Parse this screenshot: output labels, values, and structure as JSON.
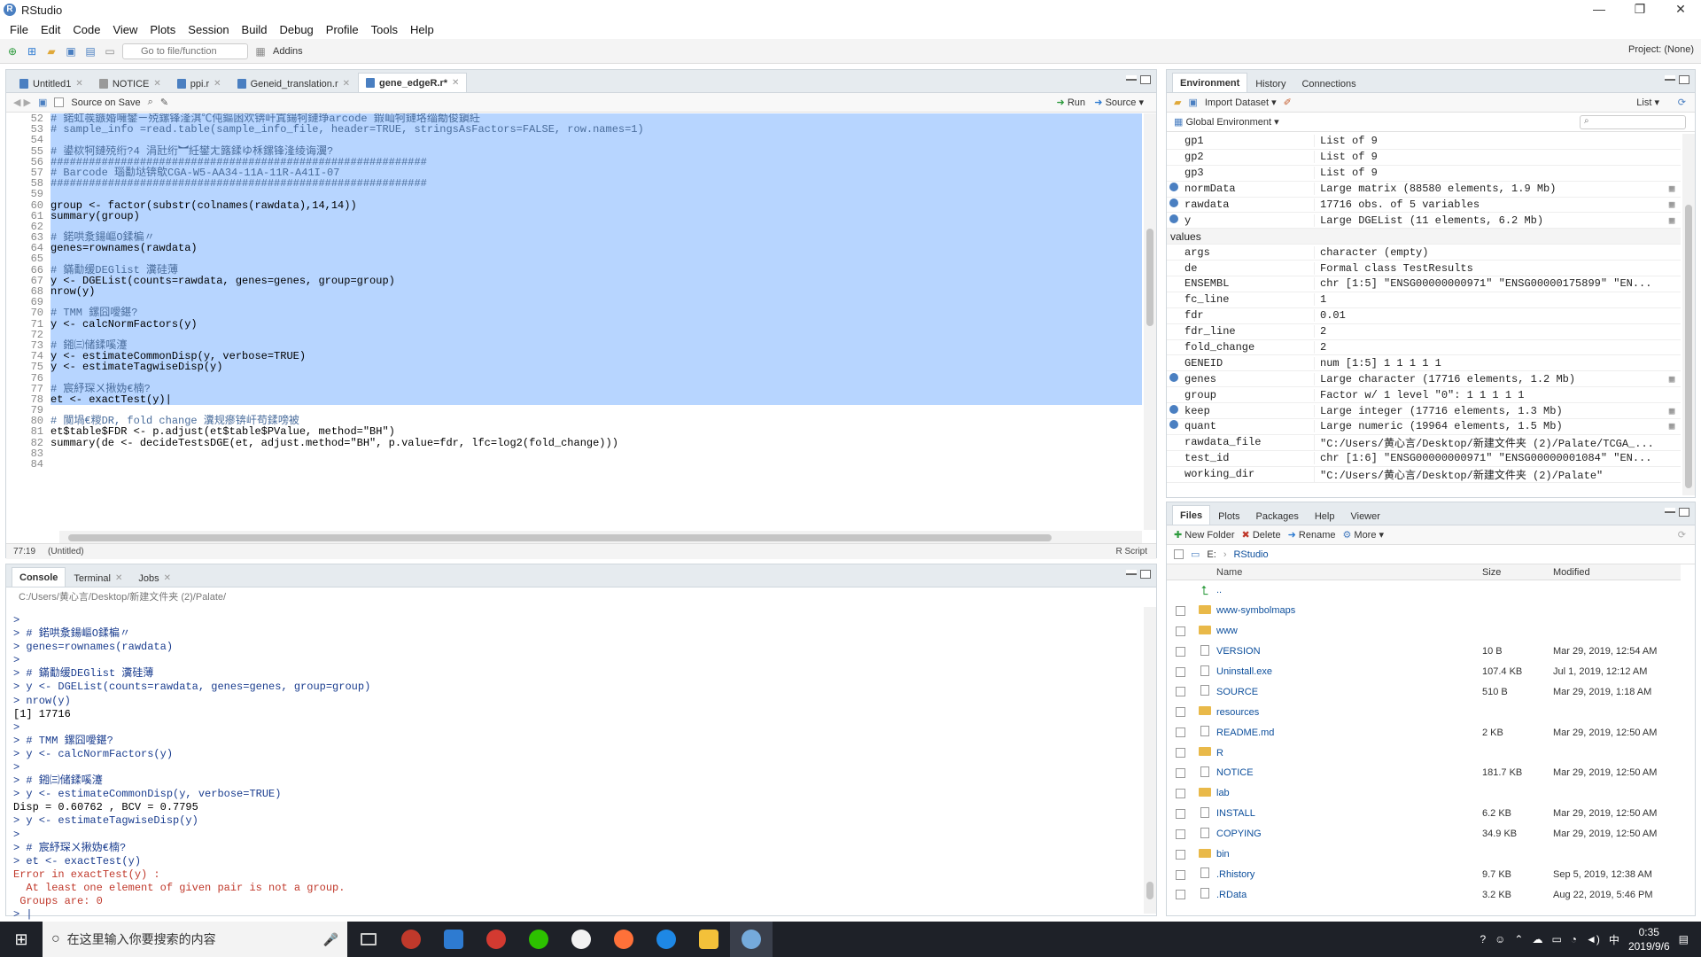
{
  "window": {
    "title": "RStudio",
    "controls": [
      "—",
      "❐",
      "✕"
    ]
  },
  "menu": [
    "File",
    "Edit",
    "Code",
    "View",
    "Plots",
    "Session",
    "Build",
    "Debug",
    "Profile",
    "Tools",
    "Help"
  ],
  "toolbar": {
    "goto_placeholder": "Go to file/function",
    "addins": "Addins",
    "project": "Project: (None)"
  },
  "editor": {
    "tabs": [
      {
        "label": "Untitled1",
        "active": false
      },
      {
        "label": "NOTICE",
        "active": false
      },
      {
        "label": "ppi.r",
        "active": false
      },
      {
        "label": "Geneid_translation.r",
        "active": false
      },
      {
        "label": "gene_edgeR.r*",
        "active": true
      }
    ],
    "source_on_save": "Source on Save",
    "run": "Run",
    "source": "Source",
    "lines": [
      {
        "n": "52",
        "t": "# 鍩虹彂鏃婚噰鐢ㄧ殑鏍锋湰淇℃伅鏂囦欢锛屽寘鍚牱鏈琤arcode 鍜屾牱鏈垎缁勪俊鎭紝",
        "sel": true,
        "cm": true
      },
      {
        "n": "53",
        "t": "# sample_info =read.table(sample_info_file, header=TRUE, stringsAsFactors=FALSE, row.names=1)",
        "sel": true,
        "cm": true
      },
      {
        "n": "54",
        "t": "",
        "sel": true
      },
      {
        "n": "55",
        "t": "# 鍙栨牱鏈殑绗?4 涓瓧绗︼紝鐢ㄤ簬鍒ゆ柇鏍锋湰绫诲瀷?",
        "sel": true,
        "cm": true
      },
      {
        "n": "56",
        "t": "###########################################################",
        "sel": true,
        "cm": true
      },
      {
        "n": "57",
        "t": "# Barcode 瑙勫垯锛歍CGA-W5-AA34-11A-11R-A41I-07",
        "sel": true,
        "cm": true
      },
      {
        "n": "58",
        "t": "###########################################################",
        "sel": true,
        "cm": true
      },
      {
        "n": "59",
        "t": "",
        "sel": true
      },
      {
        "n": "60",
        "t": "group <- factor(substr(colnames(rawdata),14,14))",
        "sel": true
      },
      {
        "n": "61",
        "t": "summary(group)",
        "sel": true
      },
      {
        "n": "62",
        "t": "",
        "sel": true
      },
      {
        "n": "63",
        "t": "# 鍩哄洜鍚嶇О鍒楄〃",
        "sel": true,
        "cm": true
      },
      {
        "n": "64",
        "t": "genes=rownames(rawdata)",
        "sel": true
      },
      {
        "n": "65",
        "t": "",
        "sel": true
      },
      {
        "n": "66",
        "t": "# 鏋勫缓DEGlist 瀵硅薄",
        "sel": true,
        "cm": true
      },
      {
        "n": "67",
        "t": "y <- DGEList(counts=rawdata, genes=genes, group=group)",
        "sel": true
      },
      {
        "n": "68",
        "t": "nrow(y)",
        "sel": true
      },
      {
        "n": "69",
        "t": "",
        "sel": true
      },
      {
        "n": "70",
        "t": "# TMM 鏍囧噯鍖?",
        "sel": true,
        "cm": true
      },
      {
        "n": "71",
        "t": "y <- calcNormFactors(y)",
        "sel": true
      },
      {
        "n": "72",
        "t": "",
        "sel": true
      },
      {
        "n": "73",
        "t": "# 鎺㈢储鍒嗘瀽",
        "sel": true,
        "cm": true
      },
      {
        "n": "74",
        "t": "y <- estimateCommonDisp(y, verbose=TRUE)",
        "sel": true
      },
      {
        "n": "75",
        "t": "y <- estimateTagwiseDisp(y)",
        "sel": true
      },
      {
        "n": "76",
        "t": "",
        "sel": true
      },
      {
        "n": "77",
        "t": "# 宸紓琛ㄨ揪妫€楠?",
        "sel": true,
        "cm": true
      },
      {
        "n": "78",
        "t": "et <- exactTest(y)|",
        "sel": true
      },
      {
        "n": "79",
        "t": "",
        "sel": false
      },
      {
        "n": "80",
        "t": "# 闃堝€糉DR, fold change 瀵规瘮锛屽苟鍒嗙被",
        "sel": false,
        "cm": true
      },
      {
        "n": "81",
        "t": "et$table$FDR <- p.adjust(et$table$PValue, method=\"BH\")",
        "sel": false
      },
      {
        "n": "82",
        "t": "summary(de <- decideTestsDGE(et, adjust.method=\"BH\", p.value=fdr, lfc=log2(fold_change)))",
        "sel": false
      },
      {
        "n": "83",
        "t": "",
        "sel": false
      },
      {
        "n": "84",
        "t": "",
        "sel": false
      }
    ],
    "status_pos": "77:19",
    "status_scope": "(Untitled)",
    "status_type": "R Script"
  },
  "console": {
    "tabs": [
      "Console",
      "Terminal",
      "Jobs"
    ],
    "path": "C:/Users/黄心言/Desktop/新建文件夹 (2)/Palate/",
    "lines": [
      {
        "c": "p",
        "t": ">"
      },
      {
        "c": "p",
        "t": "> # 鍩哄洜鍚嶇О鍒楄〃"
      },
      {
        "c": "p",
        "t": "> genes=rownames(rawdata)"
      },
      {
        "c": "p",
        "t": ">"
      },
      {
        "c": "p",
        "t": "> # 鏋勫缓DEGlist 瀵硅薄"
      },
      {
        "c": "p",
        "t": "> y <- DGEList(counts=rawdata, genes=genes, group=group)"
      },
      {
        "c": "p",
        "t": "> nrow(y)"
      },
      {
        "c": "o",
        "t": "[1] 17716"
      },
      {
        "c": "p",
        "t": ">"
      },
      {
        "c": "p",
        "t": "> # TMM 鏍囧噯鍖?"
      },
      {
        "c": "p",
        "t": "> y <- calcNormFactors(y)"
      },
      {
        "c": "p",
        "t": ">"
      },
      {
        "c": "p",
        "t": "> # 鎺㈢储鍒嗘瀽"
      },
      {
        "c": "p",
        "t": "> y <- estimateCommonDisp(y, verbose=TRUE)"
      },
      {
        "c": "o",
        "t": "Disp = 0.60762 , BCV = 0.7795"
      },
      {
        "c": "p",
        "t": "> y <- estimateTagwiseDisp(y)"
      },
      {
        "c": "p",
        "t": ">"
      },
      {
        "c": "p",
        "t": "> # 宸紓琛ㄨ揪妫€楠?"
      },
      {
        "c": "p",
        "t": "> et <- exactTest(y)"
      },
      {
        "c": "e",
        "t": "Error in exactTest(y) :"
      },
      {
        "c": "e",
        "t": "  At least one element of given pair is not a group."
      },
      {
        "c": "e",
        "t": " Groups are: 0"
      },
      {
        "c": "p",
        "t": "> |"
      }
    ]
  },
  "environment": {
    "tabs": [
      "Environment",
      "History",
      "Connections"
    ],
    "import": "Import Dataset",
    "list": "List",
    "scope": "Global Environment",
    "rows": [
      {
        "n": "gp1",
        "v": "List of 9",
        "x": false
      },
      {
        "n": "gp2",
        "v": "List of 9",
        "x": false
      },
      {
        "n": "gp3",
        "v": "List of 9",
        "x": false
      },
      {
        "n": "normData",
        "v": "Large matrix (88580 elements, 1.9 Mb)",
        "x": true
      },
      {
        "n": "rawdata",
        "v": "17716 obs. of 5 variables",
        "x": true
      },
      {
        "n": "y",
        "v": "Large DGEList (11 elements, 6.2 Mb)",
        "x": true
      },
      {
        "hdr": "values"
      },
      {
        "n": "args",
        "v": "character (empty)"
      },
      {
        "n": "de",
        "v": "Formal class TestResults"
      },
      {
        "n": "ENSEMBL",
        "v": "chr [1:5] \"ENSG00000000971\" \"ENSG00000175899\" \"EN..."
      },
      {
        "n": "fc_line",
        "v": "1"
      },
      {
        "n": "fdr",
        "v": "0.01"
      },
      {
        "n": "fdr_line",
        "v": "2"
      },
      {
        "n": "fold_change",
        "v": "2"
      },
      {
        "n": "GENEID",
        "v": "num [1:5] 1 1 1 1 1"
      },
      {
        "n": "genes",
        "v": "Large character (17716 elements, 1.2 Mb)",
        "x": true
      },
      {
        "n": "group",
        "v": "Factor w/ 1 level \"0\": 1 1 1 1 1"
      },
      {
        "n": "keep",
        "v": "Large integer (17716 elements, 1.3 Mb)",
        "x": true
      },
      {
        "n": "quant",
        "v": "Large numeric (19964 elements, 1.5 Mb)",
        "x": true
      },
      {
        "n": "rawdata_file",
        "v": "\"C:/Users/黄心言/Desktop/新建文件夹 (2)/Palate/TCGA_..."
      },
      {
        "n": "test_id",
        "v": "chr [1:6] \"ENSG00000000971\" \"ENSG00000001084\" \"EN..."
      },
      {
        "n": "working_dir",
        "v": "\"C:/Users/黄心言/Desktop/新建文件夹 (2)/Palate\""
      }
    ]
  },
  "files": {
    "tabs": [
      "Files",
      "Plots",
      "Packages",
      "Help",
      "Viewer"
    ],
    "actions": [
      "New Folder",
      "Delete",
      "Rename",
      "More"
    ],
    "path": [
      "E:",
      "RStudio"
    ],
    "headers": {
      "name": "Name",
      "size": "Size",
      "modified": "Modified"
    },
    "rows": [
      {
        "name": "..",
        "size": "",
        "mod": "",
        "k": "up"
      },
      {
        "name": "www-symbolmaps",
        "size": "",
        "mod": "",
        "k": "folder"
      },
      {
        "name": "www",
        "size": "",
        "mod": "",
        "k": "folder"
      },
      {
        "name": "VERSION",
        "size": "10 B",
        "mod": "Mar 29, 2019, 12:54 AM",
        "k": "doc"
      },
      {
        "name": "Uninstall.exe",
        "size": "107.4 KB",
        "mod": "Jul 1, 2019, 12:12 AM",
        "k": "doc"
      },
      {
        "name": "SOURCE",
        "size": "510 B",
        "mod": "Mar 29, 2019, 1:18 AM",
        "k": "doc"
      },
      {
        "name": "resources",
        "size": "",
        "mod": "",
        "k": "folder"
      },
      {
        "name": "README.md",
        "size": "2 KB",
        "mod": "Mar 29, 2019, 12:50 AM",
        "k": "doc"
      },
      {
        "name": "R",
        "size": "",
        "mod": "",
        "k": "folder"
      },
      {
        "name": "NOTICE",
        "size": "181.7 KB",
        "mod": "Mar 29, 2019, 12:50 AM",
        "k": "doc"
      },
      {
        "name": "lab",
        "size": "",
        "mod": "",
        "k": "folder"
      },
      {
        "name": "INSTALL",
        "size": "6.2 KB",
        "mod": "Mar 29, 2019, 12:50 AM",
        "k": "doc"
      },
      {
        "name": "COPYING",
        "size": "34.9 KB",
        "mod": "Mar 29, 2019, 12:50 AM",
        "k": "doc"
      },
      {
        "name": "bin",
        "size": "",
        "mod": "",
        "k": "folder"
      },
      {
        "name": ".Rhistory",
        "size": "9.7 KB",
        "mod": "Sep 5, 2019, 12:38 AM",
        "k": "doc"
      },
      {
        "name": ".RData",
        "size": "3.2 KB",
        "mod": "Aug 22, 2019, 5:46 PM",
        "k": "doc"
      }
    ]
  },
  "taskbar": {
    "search": "在这里输入你要搜索的内容",
    "time": "0:35",
    "date": "2019/9/6",
    "ime": "中"
  }
}
